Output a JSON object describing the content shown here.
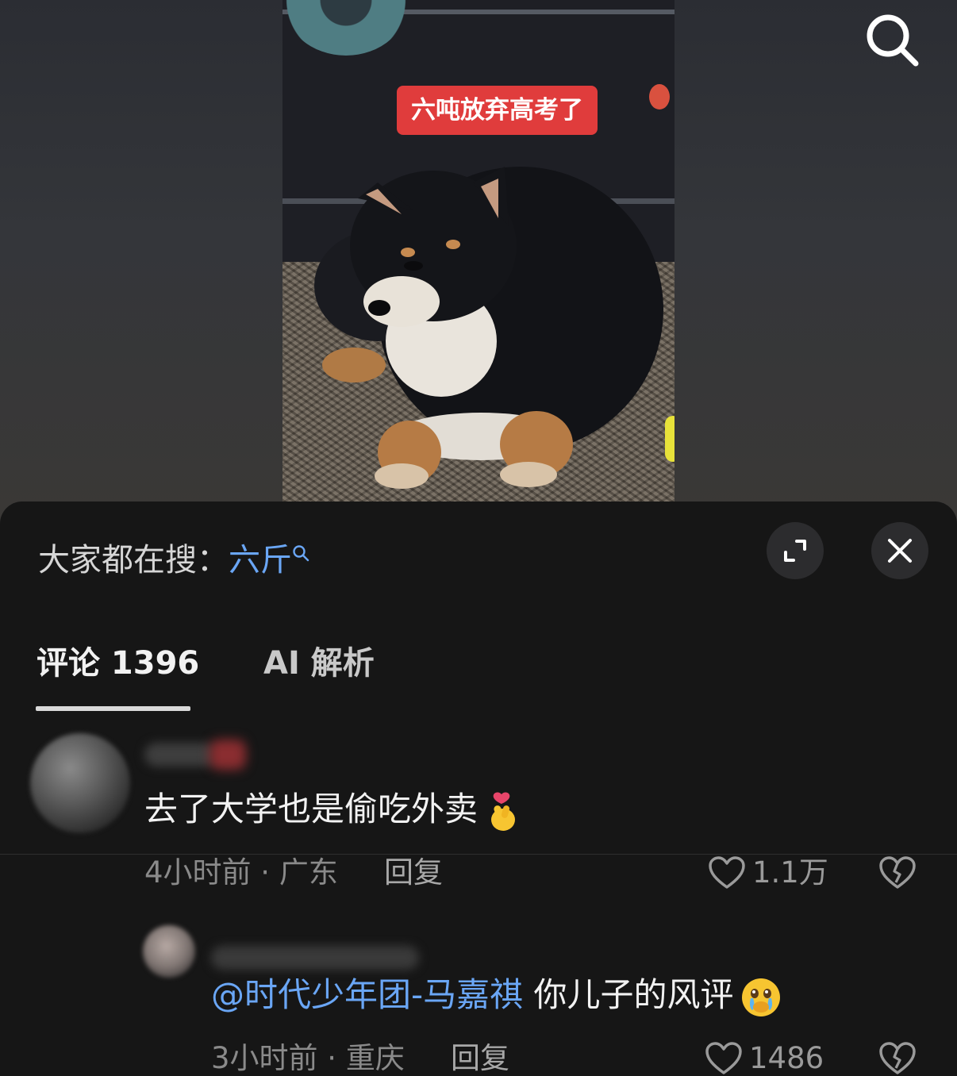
{
  "video": {
    "caption": "六吨放弃高考了"
  },
  "hot_search": {
    "label": "大家都在搜：",
    "term": "六斤"
  },
  "tabs": [
    {
      "label": "评论 1396",
      "active": true
    },
    {
      "label": "AI 解析",
      "active": false
    }
  ],
  "comments": [
    {
      "text": "去了大学也是偷吃外卖",
      "emoji": "finger-heart-emoji",
      "meta": "4小时前 · 广东",
      "reply": "回复",
      "likes": "1.1万"
    },
    {
      "mention": "@时代少年团-马嘉祺",
      "text": " 你儿子的风评",
      "emoji": "crying-face-emoji",
      "meta": "3小时前 · 重庆",
      "reply": "回复",
      "likes": "1486"
    }
  ],
  "icons": {
    "search": "search-icon",
    "expand": "expand-icon",
    "close": "close-icon",
    "like": "heart-outline-icon",
    "dislike": "broken-heart-icon"
  },
  "colors": {
    "link": "#6aa6f5",
    "caption_bg": "#e03c3c",
    "sheet_bg": "#161616"
  }
}
